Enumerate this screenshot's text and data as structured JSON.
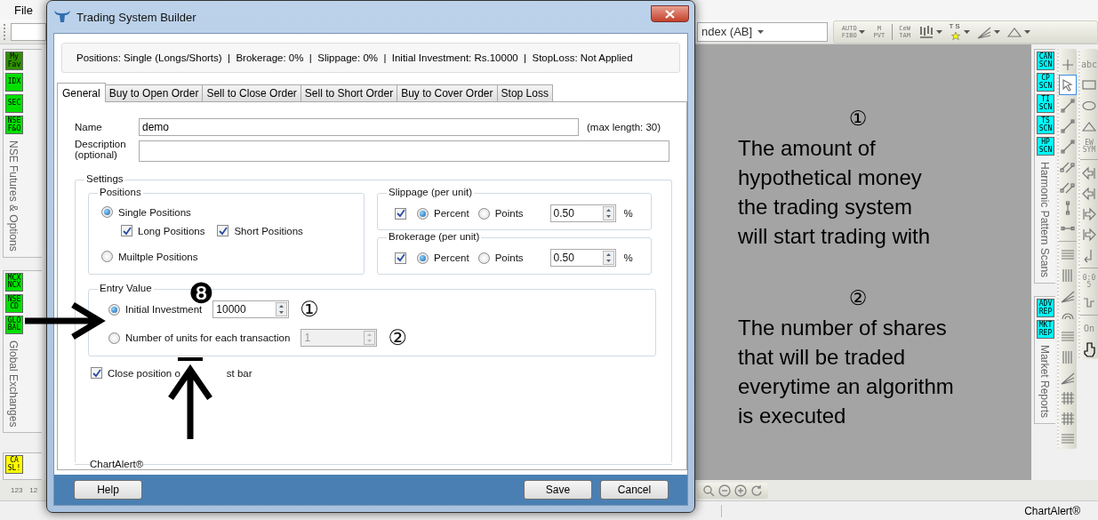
{
  "menu": [
    {
      "label": "File"
    }
  ],
  "toolbar": {
    "combo": "ndex (AB]",
    "tools": [
      {
        "kind": "text",
        "label": "AUTO FIBO",
        "dropdown": true
      },
      {
        "kind": "text",
        "label": "M PVT",
        "dropdown": false
      },
      {
        "kind": "separator"
      },
      {
        "kind": "text",
        "label": "CeW TAM",
        "dropdown": false
      },
      {
        "kind": "bars",
        "dropdown": true
      },
      {
        "kind": "star",
        "label": "TS",
        "dropdown": true
      },
      {
        "kind": "fan",
        "dropdown": true
      },
      {
        "kind": "triangle",
        "dropdown": true
      }
    ]
  },
  "left_sidebar": {
    "groups": [
      {
        "badges": [
          {
            "label": "My Fav",
            "color": "#2f8f00"
          },
          {
            "label": "IDX",
            "color": "#00e000"
          },
          {
            "label": "SEC",
            "color": "#00e000"
          },
          {
            "label": "NSE F&O",
            "color": "#00e000"
          }
        ],
        "title": "NSE Futures & Options"
      },
      {
        "badges": [
          {
            "label": "MCX NCX",
            "color": "#00e000"
          },
          {
            "label": "NSE CD",
            "color": "#00e000"
          },
          {
            "label": "GLOBAL",
            "color": "#00e000"
          }
        ],
        "title": "Global Exchanges"
      },
      {
        "badges": [
          {
            "label": "CA SL!",
            "color": "#ffff00"
          }
        ]
      }
    ]
  },
  "right_sidebar": {
    "groups": [
      {
        "badges": [
          {
            "label": "CAN SCN",
            "color": "#00ffff"
          },
          {
            "label": "CP SCN",
            "color": "#00ffff"
          },
          {
            "label": "TI SCN",
            "color": "#00ffff"
          },
          {
            "label": "TS SCN",
            "color": "#00ffff"
          },
          {
            "label": "HP SCN",
            "color": "#00ffff"
          }
        ],
        "title": "Harmonic Pattern Scans"
      },
      {
        "badges": [
          {
            "label": "ADV REP",
            "color": "#00ffff"
          },
          {
            "label": "MKT REP",
            "color": "#00ffff"
          }
        ],
        "title": "Market Reports"
      }
    ]
  },
  "drawing_tools": [
    [
      {
        "kind": "plus",
        "selected": false
      },
      {
        "kind": "cursor",
        "selected": true
      },
      {
        "kind": "line",
        "selected": false
      },
      {
        "kind": "line",
        "selected": false
      },
      {
        "kind": "line",
        "selected": false
      },
      {
        "kind": "channel",
        "selected": false
      },
      {
        "kind": "channel",
        "selected": false
      },
      {
        "kind": "vline",
        "selected": false
      },
      {
        "kind": "hline",
        "selected": false
      },
      {
        "kind": "separator"
      },
      {
        "kind": "fiblines",
        "selected": false
      },
      {
        "kind": "fibvert",
        "selected": false
      },
      {
        "kind": "fan",
        "selected": false
      },
      {
        "kind": "arc",
        "selected": false
      },
      {
        "kind": "fiblines",
        "selected": false
      },
      {
        "kind": "fibvert",
        "selected": false
      },
      {
        "kind": "fan",
        "selected": false
      },
      {
        "kind": "grid",
        "selected": false
      },
      {
        "kind": "grid",
        "selected": false
      },
      {
        "kind": "fiblines",
        "selected": false
      }
    ],
    [
      {
        "kind": "text",
        "label": "abc",
        "selected": false
      },
      {
        "kind": "rect",
        "selected": false
      },
      {
        "kind": "ellipse",
        "selected": false
      },
      {
        "kind": "triangle",
        "selected": false
      },
      {
        "kind": "text",
        "label": "EW SYM",
        "selected": false
      },
      {
        "kind": "separator"
      },
      {
        "kind": "arrowleft",
        "selected": false
      },
      {
        "kind": "arrowleft",
        "selected": false
      },
      {
        "kind": "arrowright",
        "selected": false
      },
      {
        "kind": "arrowright",
        "selected": false
      },
      {
        "kind": "turn",
        "selected": false
      },
      {
        "kind": "separator"
      },
      {
        "kind": "text",
        "label": "0:05",
        "selected": false
      },
      {
        "kind": "bracket",
        "selected": false
      },
      {
        "kind": "separator"
      },
      {
        "kind": "text",
        "label": "On",
        "selected": false
      },
      {
        "kind": "hand",
        "selected": false
      }
    ]
  ],
  "dialog": {
    "title": "Trading System Builder",
    "summary": "Positions: Single (Longs/Shorts)  |  Brokerage: 0%  |  Slippage: 0%  |  Initial Investment: Rs.10000  |  StopLoss: Not Applied",
    "tabs": [
      {
        "label": "General",
        "selected": true
      },
      {
        "label": "Buy to Open Order",
        "selected": false
      },
      {
        "label": "Sell to Close Order",
        "selected": false
      },
      {
        "label": "Sell to Short Order",
        "selected": false
      },
      {
        "label": "Buy to Cover Order",
        "selected": false
      },
      {
        "label": "Stop Loss",
        "selected": false
      }
    ],
    "name": {
      "label": "Name",
      "value": "demo",
      "hint": "(max length: 30)"
    },
    "description": {
      "label": "Description (optional)"
    },
    "settings": {
      "title": "Settings",
      "positions": {
        "title": "Positions",
        "options": [
          {
            "label": "Single Positions",
            "selected": true
          },
          {
            "label": "Muiltple Positions",
            "selected": false
          }
        ],
        "checks": [
          {
            "label": "Long Positions",
            "checked": true
          },
          {
            "label": "Short Positions",
            "checked": true
          }
        ]
      },
      "costs": [
        {
          "title": "Slippage (per unit)",
          "enabled": true,
          "modes": [
            {
              "label": "Percent",
              "selected": true
            },
            {
              "label": "Points",
              "selected": false
            }
          ],
          "value": "0.50",
          "unit": "%"
        },
        {
          "title": "Brokerage (per unit)",
          "enabled": true,
          "modes": [
            {
              "label": "Percent",
              "selected": true
            },
            {
              "label": "Points",
              "selected": false
            }
          ],
          "value": "0.50",
          "unit": "%"
        }
      ],
      "entry": {
        "title": "Entry Value",
        "options": [
          {
            "label": "Initial Investment",
            "selected": true,
            "value": "10000",
            "disabled": false,
            "callout": "①"
          },
          {
            "label": "Number of units for each transaction",
            "selected": false,
            "value": "1",
            "disabled": true,
            "callout": "②"
          }
        ]
      },
      "close_on_last_bar": {
        "label_parts": [
          "Close position o",
          "st bar"
        ],
        "checked": true
      },
      "footer_label": "ChartAlert®"
    },
    "buttons": [
      {
        "label": "Help",
        "kind": "left"
      },
      {
        "label": "Save",
        "kind": "right"
      },
      {
        "label": "Cancel",
        "kind": "right"
      }
    ]
  },
  "marker": "❽",
  "notes": [
    {
      "number": "①",
      "lines": [
        "The amount of",
        "hypothetical money",
        "the trading system",
        "will start trading with"
      ]
    },
    {
      "number": "②",
      "lines": [
        "The number of shares",
        "that will be traded",
        "everytime an algorithm",
        "is executed"
      ]
    }
  ],
  "bottom_toolbar": {
    "labels": [
      "123",
      "12"
    ]
  },
  "status_bar": {
    "text": "ChartAlert®"
  }
}
